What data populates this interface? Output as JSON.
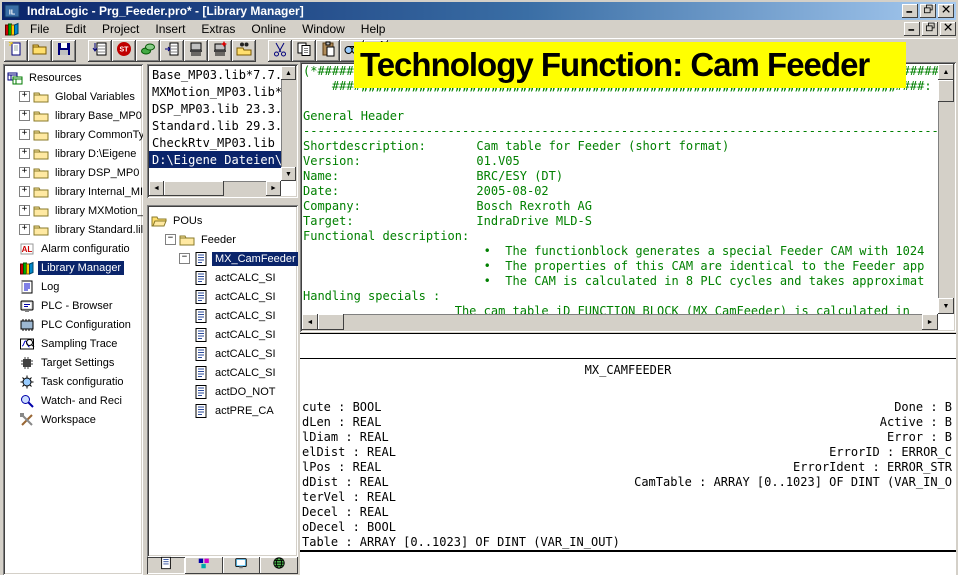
{
  "window": {
    "title": "IndraLogic - Prg_Feeder.pro* - [Library Manager]",
    "buttons": [
      "minimize",
      "restore",
      "close"
    ]
  },
  "menu": {
    "items": [
      "File",
      "Edit",
      "Project",
      "Insert",
      "Extras",
      "Online",
      "Window",
      "Help"
    ]
  },
  "toolbar": {
    "groups": [
      [
        "new",
        "open",
        "save"
      ],
      [
        "download",
        "stop",
        "eraser",
        "import",
        "printer",
        "printer-star",
        "lib-open"
      ],
      [
        "cut",
        "copy",
        "paste",
        "find",
        "find-next"
      ]
    ]
  },
  "banner": {
    "text": "Technology Function: Cam Feeder",
    "bg": "#ffff00"
  },
  "resources_panel": {
    "items": [
      {
        "label": "Resources",
        "icon": "resources-root",
        "box": null,
        "level": 0
      },
      {
        "label": "Global Variables",
        "icon": "folder",
        "box": "plus",
        "level": 1
      },
      {
        "label": "library Base_MP0",
        "icon": "folder",
        "box": "plus",
        "level": 1
      },
      {
        "label": "library CommonTy",
        "icon": "folder",
        "box": "plus",
        "level": 1
      },
      {
        "label": "library D:\\Eigene",
        "icon": "folder",
        "box": "plus",
        "level": 1
      },
      {
        "label": "library DSP_MP0",
        "icon": "folder",
        "box": "plus",
        "level": 1
      },
      {
        "label": "library Internal_MI",
        "icon": "folder",
        "box": "plus",
        "level": 1
      },
      {
        "label": "library MXMotion_",
        "icon": "folder",
        "box": "plus",
        "level": 1
      },
      {
        "label": "library Standard.lil",
        "icon": "folder",
        "box": "plus",
        "level": 1
      },
      {
        "label": "Alarm configuratio",
        "icon": "alarm",
        "box": null,
        "level": 1
      },
      {
        "label": "Library Manager",
        "icon": "books",
        "box": null,
        "level": 1,
        "selected": true
      },
      {
        "label": "Log",
        "icon": "log",
        "box": null,
        "level": 1
      },
      {
        "label": "PLC - Browser",
        "icon": "plc-browser",
        "box": null,
        "level": 1
      },
      {
        "label": "PLC Configuration",
        "icon": "plc-config",
        "box": null,
        "level": 1
      },
      {
        "label": "Sampling Trace",
        "icon": "sampling",
        "box": null,
        "level": 1
      },
      {
        "label": "Target Settings",
        "icon": "target",
        "box": null,
        "level": 1
      },
      {
        "label": "Task configuratio",
        "icon": "task",
        "box": null,
        "level": 1
      },
      {
        "label": "Watch- and Reci",
        "icon": "watch",
        "box": null,
        "level": 1
      },
      {
        "label": "Workspace",
        "icon": "workspace",
        "box": null,
        "level": 1
      }
    ]
  },
  "library_list": {
    "items": [
      "Base_MP03.lib*7.7.",
      "MXMotion_MP03.lib*",
      "DSP_MP03.lib 23.3.",
      "Standard.lib 29.3.",
      "CheckRtv_MP03.lib",
      "D:\\Eigene Dateien\\"
    ],
    "selected_index": 5
  },
  "pou_panel": {
    "items": [
      {
        "label": "POUs",
        "icon": "folder-open",
        "box": null,
        "level": 0
      },
      {
        "label": "Feeder",
        "icon": "folder",
        "box": "minus",
        "level": 1
      },
      {
        "label": "MX_CamFeeder",
        "icon": "doc",
        "box": "minus",
        "level": 2,
        "selected": true
      },
      {
        "label": "actCALC_SI",
        "icon": "doc",
        "box": null,
        "level": 3
      },
      {
        "label": "actCALC_SI",
        "icon": "doc",
        "box": null,
        "level": 3
      },
      {
        "label": "actCALC_SI",
        "icon": "doc",
        "box": null,
        "level": 3
      },
      {
        "label": "actCALC_SI",
        "icon": "doc",
        "box": null,
        "level": 3
      },
      {
        "label": "actCALC_SI",
        "icon": "doc",
        "box": null,
        "level": 3
      },
      {
        "label": "actCALC_SI",
        "icon": "doc",
        "box": null,
        "level": 3
      },
      {
        "label": "actDO_NOT",
        "icon": "doc",
        "box": null,
        "level": 3
      },
      {
        "label": "actPRE_CA",
        "icon": "doc",
        "box": null,
        "level": 3
      }
    ],
    "tabs": [
      "doc-tab",
      "blocks-tab",
      "vis-tab",
      "globe-tab"
    ]
  },
  "code_view": {
    "lines": [
      "(*##################################################################################################",
      "    ####„„„„„„„„„„„„„„„„„„„„„„„„„„„„„„„„„„„„„„„„„„„„„„„„„„„„„„„„„„„„„„„„„„„„„„„„„„####:",
      "",
      "General Header",
      "--------------------------------------------------------------------------------------------",
      "Shortdescription:       Cam table for Feeder (short format)",
      "Version:                01.V05",
      "Name:                   BRC/ESY (DT)",
      "Date:                   2005-08-02",
      "Company:                Bosch Rexroth AG",
      "Target:                 IndraDrive MLD-S",
      "Functional description:",
      "                         •  The functionblock generates a special Feeder CAM with 1024",
      "                         •  The properties of this CAM are identical to the Feeder app",
      "                         •  The CAM is calculated in 8 PLC cycles and takes approximat",
      "Handling specials :",
      "                     The cam table iD FUNCTION BLOCK (MX_CamFeeder) is calculated in"
    ]
  },
  "block_view": {
    "title": "MX_CAMFEEDER",
    "inputs": [
      "cute : BOOL",
      "dLen : REAL",
      "lDiam : REAL",
      "elDist : REAL",
      "lPos : REAL",
      "dDist : REAL",
      "terVel : REAL",
      "Decel : REAL",
      "oDecel : BOOL",
      "Table : ARRAY [0..1023] OF DINT (VAR_IN_OUT)"
    ],
    "outputs": [
      "Done : B",
      "Active : B",
      "Error : B",
      "ErrorID : ERROR_C",
      "ErrorIdent : ERROR_STR",
      "CamTable : ARRAY [0..1023] OF DINT (VAR_IN_O",
      "",
      "",
      "",
      ""
    ]
  },
  "colors": {
    "selection": "#0a246a",
    "titlebar_start": "#0a246a",
    "titlebar_end": "#a6caf0",
    "code_green": "#008000",
    "banner_yellow": "#ffff00",
    "chrome_gray": "#d4d0c8"
  }
}
